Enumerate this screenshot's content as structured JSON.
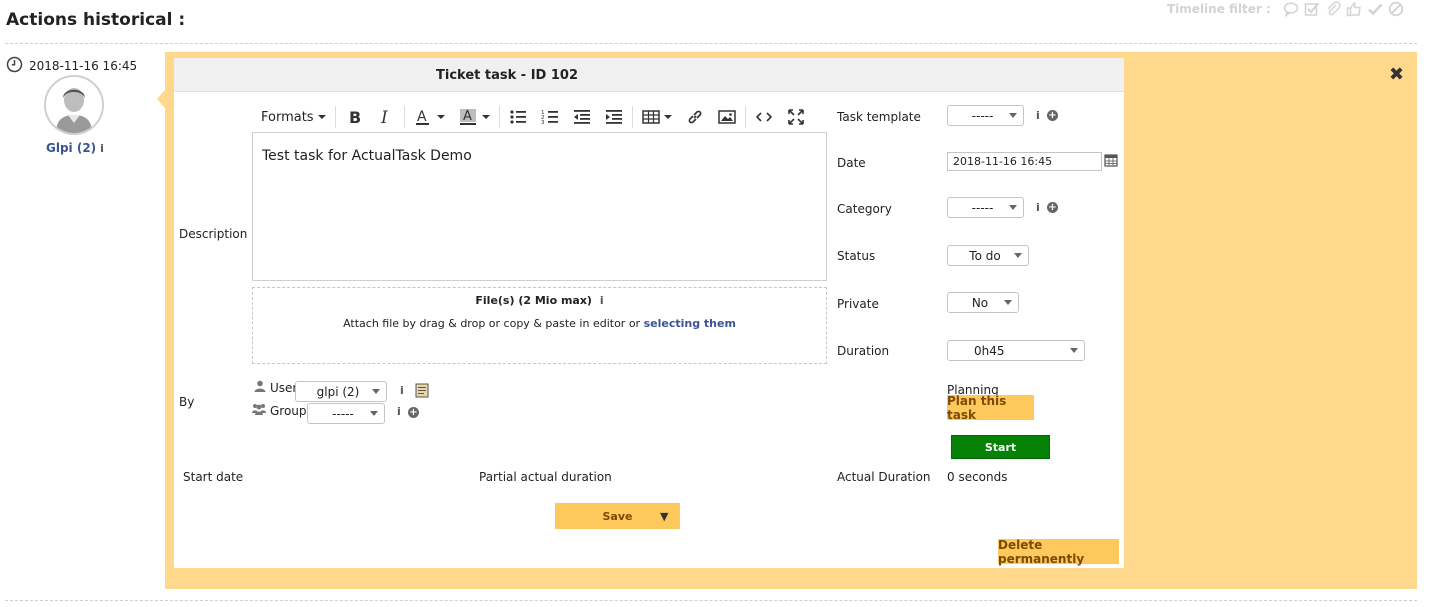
{
  "header": {
    "title": "Actions historical :",
    "timeline_filter_label": "Timeline filter :",
    "filter_icons": [
      "comment-icon",
      "checkbox-icon",
      "paperclip-icon",
      "thumbs-up-icon",
      "check-icon",
      "ban-icon"
    ]
  },
  "entry": {
    "datetime": "2018-11-16 16:45",
    "author": "Glpi (2)",
    "author_info": "i"
  },
  "task": {
    "title": "Ticket task - ID 102",
    "close": "✖",
    "description_label": "Description",
    "editor": {
      "formats_label": "Formats",
      "content": "Test task for ActualTask Demo"
    },
    "files": {
      "title": "File(s) (2 Mio max)",
      "info": "i",
      "text": "Attach file by drag & drop or copy & paste in editor or",
      "link": "selecting them"
    },
    "by_label": "By",
    "user_label": "User",
    "user_value": "glpi (2)",
    "group_label": "Group",
    "group_value": "-----",
    "fields": {
      "template_label": "Task template",
      "template_value": "-----",
      "date_label": "Date",
      "date_value": "2018-11-16 16:45",
      "category_label": "Category",
      "category_value": "-----",
      "status_label": "Status",
      "status_value": "To do",
      "private_label": "Private",
      "private_value": "No",
      "duration_label": "Duration",
      "duration_value": "0h45"
    },
    "planning": {
      "label": "Planning",
      "plan_button": "Plan this task"
    },
    "start_button": "Start",
    "start_date_label": "Start date",
    "partial_duration_label": "Partial actual duration",
    "actual_duration_label": "Actual Duration",
    "actual_duration_value": "0 seconds",
    "save_button": "Save",
    "save_caret": "▼",
    "delete_button": "Delete permanently",
    "info": "i",
    "plus": "+"
  },
  "colors": {
    "panel_bg": "#ffd88c",
    "button_yellow": "#fec95c",
    "button_green": "#058105",
    "link": "#3a5393"
  }
}
